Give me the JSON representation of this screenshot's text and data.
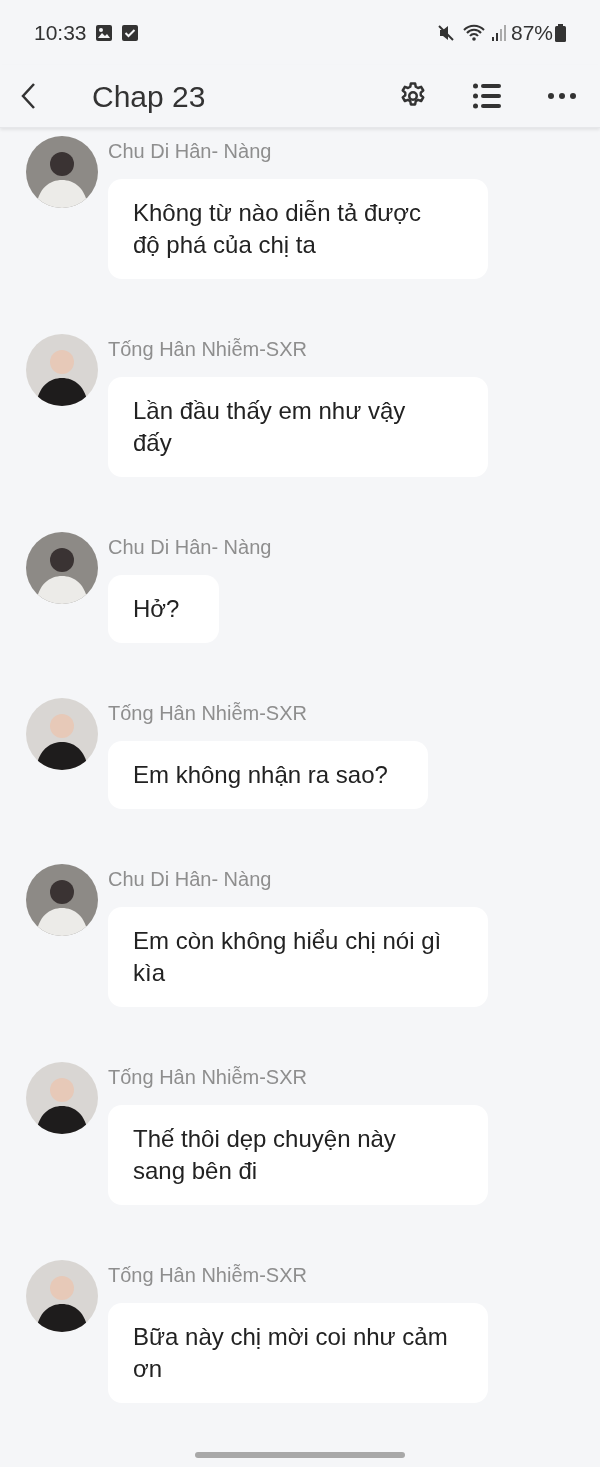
{
  "status_bar": {
    "time": "10:33",
    "battery": "87%"
  },
  "header": {
    "title": "Chap 23"
  },
  "messages": [
    {
      "sender": "Chu Di Hân- Nàng",
      "kind": "light",
      "text": "Không từ nào diễn tả được độ phá của chị ta"
    },
    {
      "sender": "Tống Hân Nhiễm-SXR",
      "kind": "dark",
      "text": "Lần đầu thấy em như vậy đấy"
    },
    {
      "sender": "Chu Di Hân- Nàng",
      "kind": "light",
      "text": "Hở?"
    },
    {
      "sender": "Tống Hân Nhiễm-SXR",
      "kind": "dark",
      "text": "Em không nhận ra sao?"
    },
    {
      "sender": "Chu Di Hân- Nàng",
      "kind": "light",
      "text": "Em còn không hiểu chị nói gì kìa"
    },
    {
      "sender": "Tống Hân Nhiễm-SXR",
      "kind": "dark",
      "text": "Thế thôi dẹp chuyện này sang bên đi"
    },
    {
      "sender": "Tống Hân Nhiễm-SXR",
      "kind": "dark",
      "text": "Bữa này chị mời coi như cảm ơn"
    }
  ]
}
